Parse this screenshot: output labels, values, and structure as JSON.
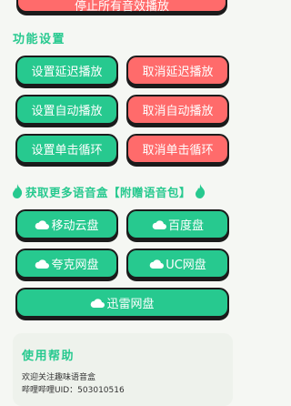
{
  "top_button": {
    "label": "停止所有音效播放"
  },
  "function_settings": {
    "title": "功能设置",
    "buttons": [
      {
        "label": "设置延迟播放"
      },
      {
        "label": "取消延迟播放"
      },
      {
        "label": "设置自动播放"
      },
      {
        "label": "取消自动播放"
      },
      {
        "label": "设置单击循环"
      },
      {
        "label": "取消单击循环"
      }
    ]
  },
  "download_section": {
    "title": "获取更多语音盒【附赠语音包】",
    "buttons": [
      {
        "label": "移动云盘"
      },
      {
        "label": "百度盘"
      },
      {
        "label": "夸克网盘"
      },
      {
        "label": "UC网盘"
      },
      {
        "label": "迅雷网盘"
      }
    ]
  },
  "help": {
    "title": "使用帮助",
    "lines": [
      "欢迎关注趣味语音盒",
      "哔哩哔哩UID：503010516"
    ]
  },
  "colors": {
    "accent_green": "#27c98f",
    "accent_red": "#ff6b6b",
    "background": "#f5f7f3"
  },
  "icons": {
    "cloud": "cloud-icon",
    "fire": "fire-icon"
  }
}
